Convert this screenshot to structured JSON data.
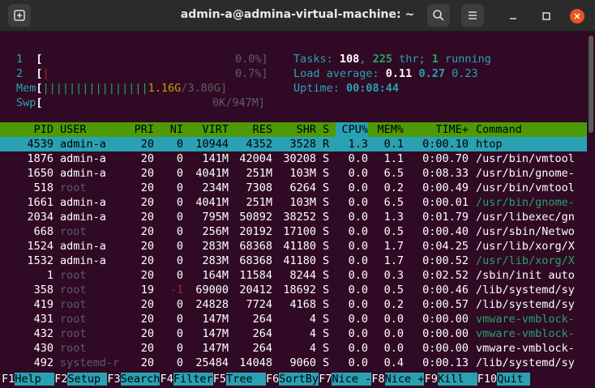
{
  "window": {
    "title": "admin-a@admina-virtual-machine: ~"
  },
  "meters": {
    "cpu1": {
      "label": "1",
      "value": "0.0%]"
    },
    "cpu2": {
      "label": "2",
      "value": "0.7%]"
    },
    "mem": {
      "label": "Mem",
      "bars": "||||||||||||||||",
      "used": "1.16G",
      "total": "/3.80G]"
    },
    "swp": {
      "label": "Swp",
      "value": "0K/947M]"
    }
  },
  "stats": {
    "tasks_label": "Tasks: ",
    "tasks": "108",
    "thr": "225",
    "thr_label": " thr; ",
    "running": "1",
    "running_label": " running",
    "load_label": "Load average: ",
    "load1": "0.11",
    "load5": "0.27",
    "load15": "0.23",
    "uptime_label": "Uptime: ",
    "uptime": "00:08:44"
  },
  "columns": [
    "PID",
    "USER",
    "PRI",
    "NI",
    "VIRT",
    "RES",
    "SHR",
    "S",
    "CPU%",
    "MEM%",
    "TIME+",
    "Command"
  ],
  "processes": [
    {
      "pid": "4539",
      "user": "admin-a",
      "pri": "20",
      "ni": "0",
      "virt": "10944",
      "res": "4352",
      "shr": "3528",
      "s": "R",
      "cpu": "1.3",
      "mem": "0.1",
      "time": "0:00.10",
      "cmd": "htop"
    },
    {
      "pid": "1876",
      "user": "admin-a",
      "pri": "20",
      "ni": "0",
      "virt": "141M",
      "res": "42004",
      "shr": "30208",
      "s": "S",
      "cpu": "0.0",
      "mem": "1.1",
      "time": "0:00.70",
      "cmd": "/usr/bin/vmtool"
    },
    {
      "pid": "1650",
      "user": "admin-a",
      "pri": "20",
      "ni": "0",
      "virt": "4041M",
      "res": "251M",
      "shr": "103M",
      "s": "S",
      "cpu": "0.0",
      "mem": "6.5",
      "time": "0:08.33",
      "cmd": "/usr/bin/gnome-"
    },
    {
      "pid": "518",
      "user": "root",
      "pri": "20",
      "ni": "0",
      "virt": "234M",
      "res": "7308",
      "shr": "6264",
      "s": "S",
      "cpu": "0.0",
      "mem": "0.2",
      "time": "0:00.49",
      "cmd": "/usr/bin/vmtool"
    },
    {
      "pid": "1661",
      "user": "admin-a",
      "pri": "20",
      "ni": "0",
      "virt": "4041M",
      "res": "251M",
      "shr": "103M",
      "s": "S",
      "cpu": "0.0",
      "mem": "6.5",
      "time": "0:00.01",
      "cmd": "/usr/bin/gnome-"
    },
    {
      "pid": "2034",
      "user": "admin-a",
      "pri": "20",
      "ni": "0",
      "virt": "795M",
      "res": "50892",
      "shr": "38252",
      "s": "S",
      "cpu": "0.0",
      "mem": "1.3",
      "time": "0:01.79",
      "cmd": "/usr/libexec/gn"
    },
    {
      "pid": "668",
      "user": "root",
      "pri": "20",
      "ni": "0",
      "virt": "256M",
      "res": "20192",
      "shr": "17100",
      "s": "S",
      "cpu": "0.0",
      "mem": "0.5",
      "time": "0:00.40",
      "cmd": "/usr/sbin/Netwo"
    },
    {
      "pid": "1524",
      "user": "admin-a",
      "pri": "20",
      "ni": "0",
      "virt": "283M",
      "res": "68368",
      "shr": "41180",
      "s": "S",
      "cpu": "0.0",
      "mem": "1.7",
      "time": "0:04.25",
      "cmd": "/usr/lib/xorg/X"
    },
    {
      "pid": "1532",
      "user": "admin-a",
      "pri": "20",
      "ni": "0",
      "virt": "283M",
      "res": "68368",
      "shr": "41180",
      "s": "S",
      "cpu": "0.0",
      "mem": "1.7",
      "time": "0:00.52",
      "cmd": "/usr/lib/xorg/X"
    },
    {
      "pid": "1",
      "user": "root",
      "pri": "20",
      "ni": "0",
      "virt": "164M",
      "res": "11584",
      "shr": "8244",
      "s": "S",
      "cpu": "0.0",
      "mem": "0.3",
      "time": "0:02.52",
      "cmd": "/sbin/init auto"
    },
    {
      "pid": "358",
      "user": "root",
      "pri": "19",
      "ni": "-1",
      "virt": "69000",
      "res": "20412",
      "shr": "18692",
      "s": "S",
      "cpu": "0.0",
      "mem": "0.5",
      "time": "0:00.46",
      "cmd": "/lib/systemd/sy"
    },
    {
      "pid": "419",
      "user": "root",
      "pri": "20",
      "ni": "0",
      "virt": "24828",
      "res": "7724",
      "shr": "4168",
      "s": "S",
      "cpu": "0.0",
      "mem": "0.2",
      "time": "0:00.57",
      "cmd": "/lib/systemd/sy"
    },
    {
      "pid": "431",
      "user": "root",
      "pri": "20",
      "ni": "0",
      "virt": "147M",
      "res": "264",
      "shr": "4",
      "s": "S",
      "cpu": "0.0",
      "mem": "0.0",
      "time": "0:00.00",
      "cmd": "vmware-vmblock-"
    },
    {
      "pid": "432",
      "user": "root",
      "pri": "20",
      "ni": "0",
      "virt": "147M",
      "res": "264",
      "shr": "4",
      "s": "S",
      "cpu": "0.0",
      "mem": "0.0",
      "time": "0:00.00",
      "cmd": "vmware-vmblock-"
    },
    {
      "pid": "430",
      "user": "root",
      "pri": "20",
      "ni": "0",
      "virt": "147M",
      "res": "264",
      "shr": "4",
      "s": "S",
      "cpu": "0.0",
      "mem": "0.0",
      "time": "0:00.00",
      "cmd": "vmware-vmblock-"
    },
    {
      "pid": "492",
      "user": "systemd-r",
      "pri": "20",
      "ni": "0",
      "virt": "25484",
      "res": "14048",
      "shr": "9060",
      "s": "S",
      "cpu": "0.0",
      "mem": "0.4",
      "time": "0:00.13",
      "cmd": "/lib/systemd/sy"
    }
  ],
  "fkeys": [
    {
      "key": "F1",
      "label": "Help  "
    },
    {
      "key": "F2",
      "label": "Setup "
    },
    {
      "key": "F3",
      "label": "Search"
    },
    {
      "key": "F4",
      "label": "Filter"
    },
    {
      "key": "F5",
      "label": "Tree  "
    },
    {
      "key": "F6",
      "label": "SortBy"
    },
    {
      "key": "F7",
      "label": "Nice -"
    },
    {
      "key": "F8",
      "label": "Nice +"
    },
    {
      "key": "F9",
      "label": "Kill  "
    },
    {
      "key": "F10",
      "label": "Quit "
    }
  ],
  "colors": {
    "header_bg": "#4e9a06",
    "selection_bg": "#2aa1b3",
    "terminal_bg": "#300a24",
    "close_button": "#e95420"
  }
}
